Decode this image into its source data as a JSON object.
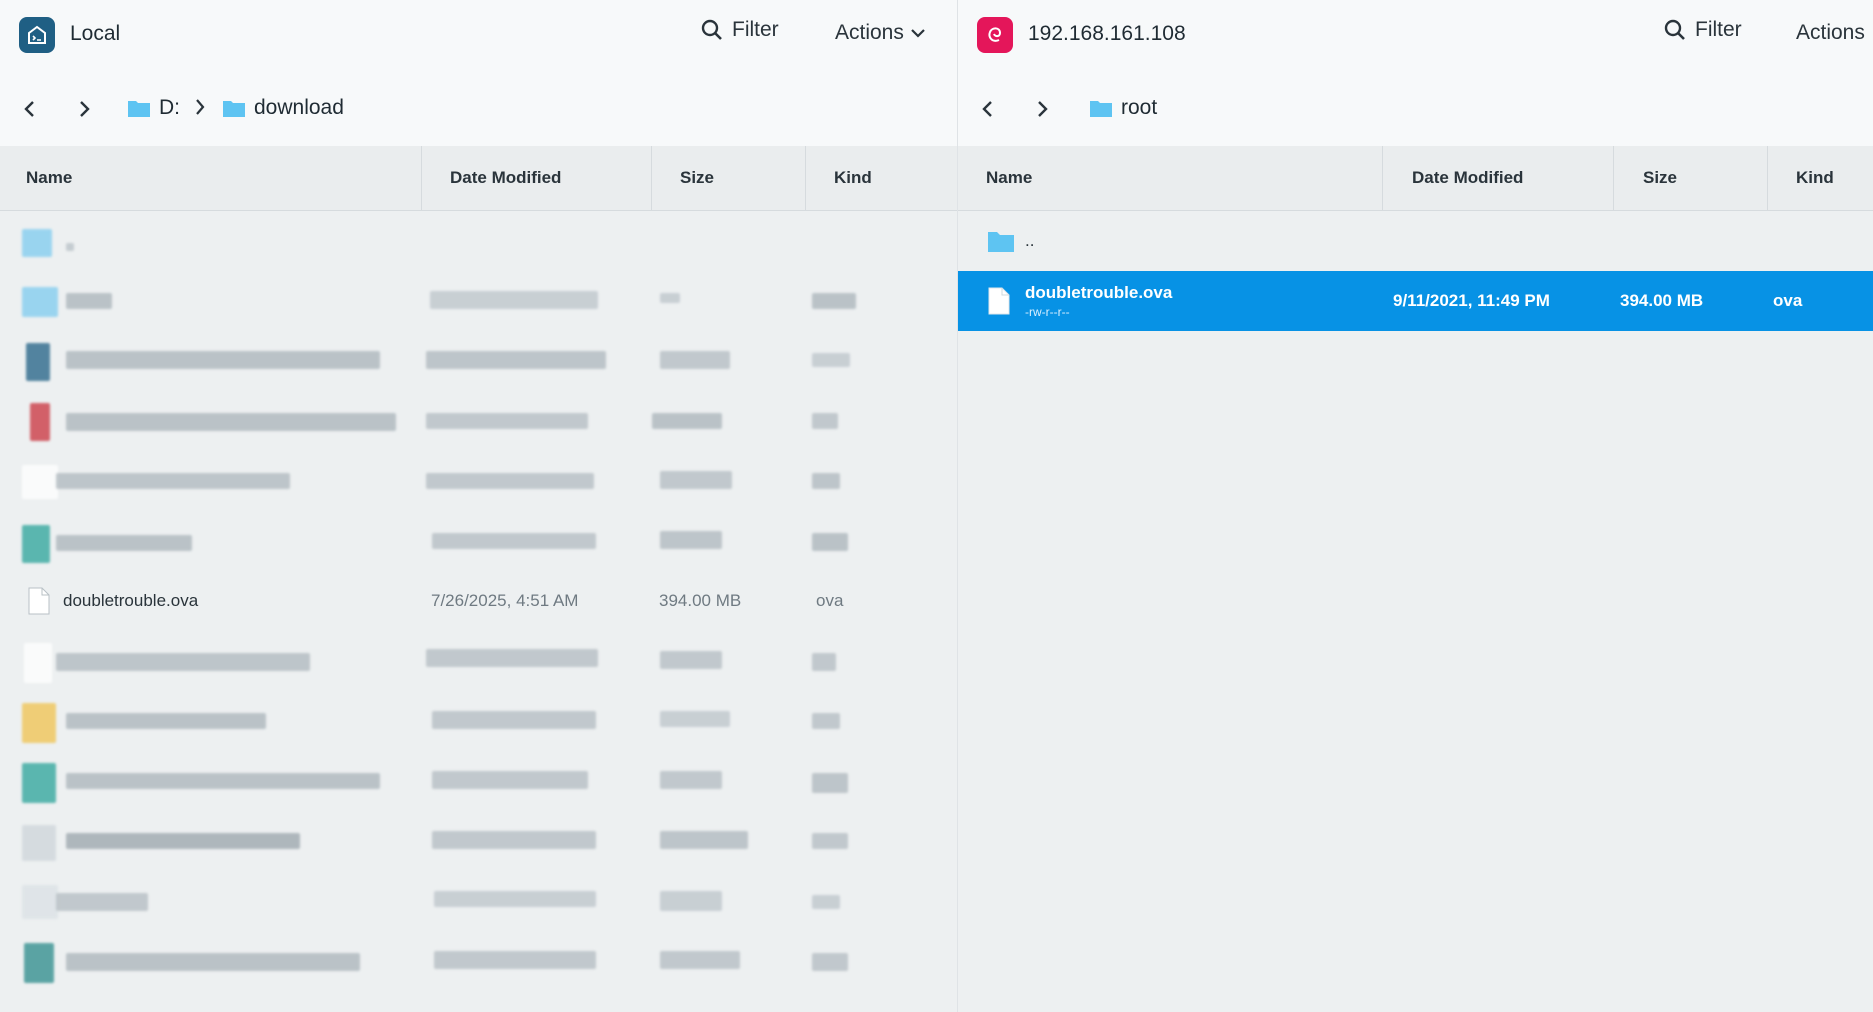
{
  "local": {
    "title": "Local",
    "filter_label": "Filter",
    "actions_label": "Actions",
    "breadcrumb": [
      "D:",
      "download"
    ],
    "columns": [
      "Name",
      "Date Modified",
      "Size",
      "Kind"
    ],
    "visible_file": {
      "name": "doubletrouble.ova",
      "modified": "7/26/2025, 4:51 AM",
      "size": "394.00 MB",
      "kind": "ova"
    }
  },
  "remote": {
    "title": "192.168.161.108",
    "filter_label": "Filter",
    "actions_label": "Actions",
    "breadcrumb": [
      "root"
    ],
    "columns": [
      "Name",
      "Date Modified",
      "Size",
      "Kind"
    ],
    "parent_label": "..",
    "selected_file": {
      "name": "doubletrouble.ova",
      "permissions": "-rw-r--r--",
      "modified": "9/11/2021, 11:49 PM",
      "size": "394.00 MB",
      "kind": "ova"
    }
  },
  "colors": {
    "local_icon": "#1f5f84",
    "remote_icon": "#e4165a",
    "selection": "#0792e5",
    "folder": "#5ec4f2"
  }
}
